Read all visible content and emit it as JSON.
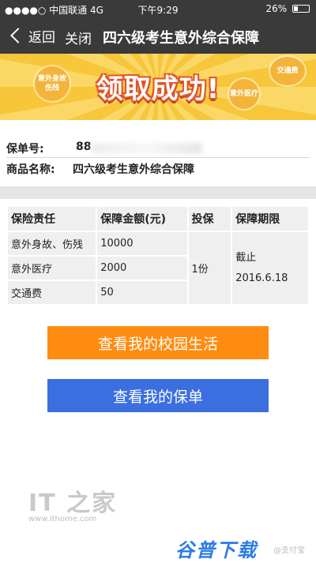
{
  "status_bar": {
    "carrier": "●●●●○ 中国联通 4G",
    "time": "下午9:29",
    "battery": "26%"
  },
  "nav": {
    "back_label": "返回",
    "close_label": "关闭",
    "title": "四六级考生意外综合保障"
  },
  "banner": {
    "headline": "领取成功!",
    "bubble_1": "意外身故伤残",
    "bubble_2": "意外医疗",
    "bubble_3": "交通费"
  },
  "policy": {
    "number_label": "保单号:",
    "number_value": "88",
    "product_label": "商品名称:",
    "product_value": "四六级考生意外综合保障"
  },
  "coverage_table": {
    "headers": [
      "保险责任",
      "保障金额(元)",
      "投保",
      "保障期限"
    ],
    "rows": [
      {
        "item": "意外身故、伤残",
        "amount": "10000"
      },
      {
        "item": "意外医疗",
        "amount": "2000"
      },
      {
        "item": "交通费",
        "amount": "50"
      }
    ],
    "quantity": "1份",
    "period_line1": "截止",
    "period_line2": "2016.6.18"
  },
  "buttons": {
    "campus_life": "查看我的校园生活",
    "my_policy": "查看我的保单"
  },
  "watermarks": {
    "it_logo": "IT 之家",
    "it_url": "www.ithome.com",
    "download_logo": "谷普下载",
    "handle": "@支付宝"
  },
  "colors": {
    "nav_bg": "#3a3a3a",
    "orange_button": "#ff8c12",
    "blue_button": "#3b6fe0",
    "banner_yellow": "#f7c63a"
  }
}
